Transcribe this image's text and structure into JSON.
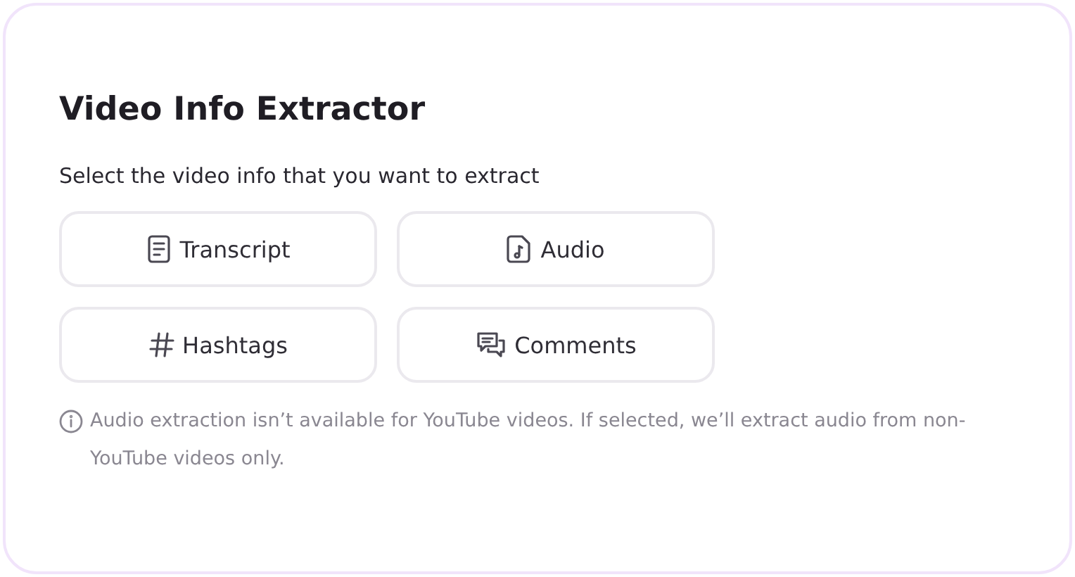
{
  "title": "Video Info Extractor",
  "prompt": "Select the video info that you want to extract",
  "options": [
    {
      "label": "Transcript",
      "kind": "transcript",
      "selected": false
    },
    {
      "label": "Audio",
      "kind": "audio",
      "selected": false
    },
    {
      "label": "Hashtags",
      "kind": "hashtags",
      "selected": false
    },
    {
      "label": "Comments",
      "kind": "comments",
      "selected": false
    }
  ],
  "note": "Audio extraction isn’t available for YouTube videos. If selected, we’ll extract audio from non-YouTube videos only."
}
